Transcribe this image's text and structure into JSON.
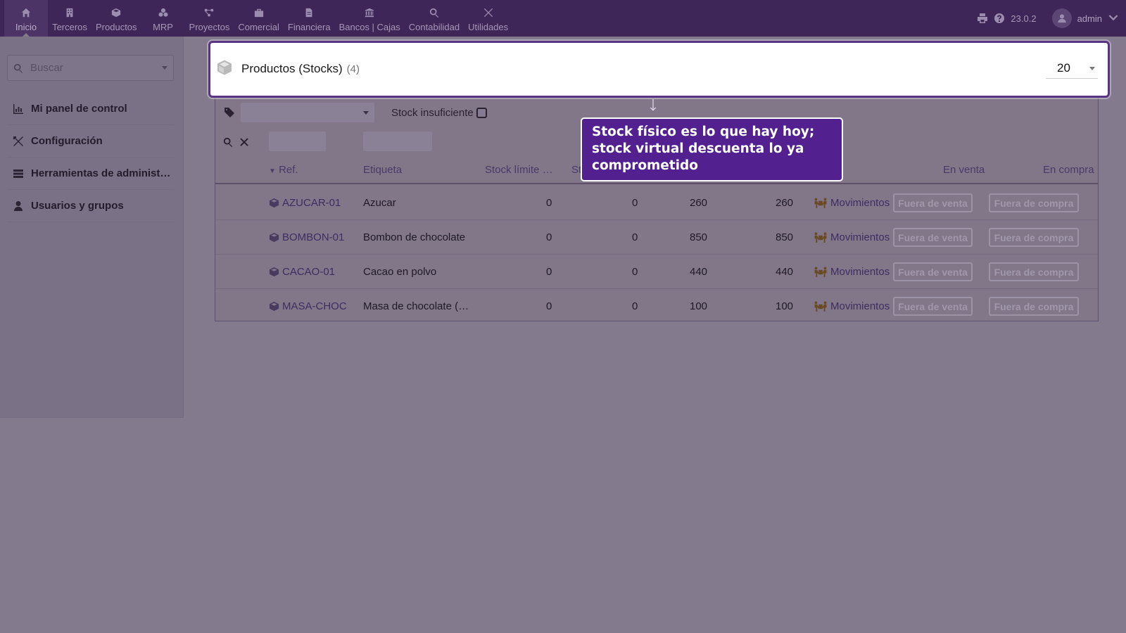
{
  "topbar": {
    "menu": [
      {
        "label": "Inicio",
        "icon": "home-icon",
        "active": true
      },
      {
        "label": "Terceros",
        "icon": "building-icon"
      },
      {
        "label": "Productos",
        "icon": "cube-icon"
      },
      {
        "label": "MRP",
        "icon": "cubes-icon"
      },
      {
        "label": "Proyectos",
        "icon": "project-diagram-icon"
      },
      {
        "label": "Comercial",
        "icon": "suitcase-icon"
      },
      {
        "label": "Financiera",
        "icon": "file-invoice-icon"
      },
      {
        "label": "Bancos | Cajas",
        "icon": "bank-icon"
      },
      {
        "label": "Contabilidad",
        "icon": "search-dollar-icon"
      },
      {
        "label": "Utilidades",
        "icon": "tools-icon"
      }
    ],
    "version": "23.0.2",
    "user": "admin"
  },
  "sidebar": {
    "search_placeholder": "Buscar",
    "items": [
      {
        "label": "Mi panel de control",
        "icon": "chart-bar-icon"
      },
      {
        "label": "Configuración",
        "icon": "tools-icon"
      },
      {
        "label": "Herramientas de administración",
        "icon": "server-icon"
      },
      {
        "label": "Usuarios y grupos",
        "icon": "user-icon"
      }
    ]
  },
  "popup": {
    "title": "Productos (Stocks)",
    "count": "(4)",
    "page_size": "20"
  },
  "filters": {
    "stock_insuficiente_label": "Stock insuficiente"
  },
  "table": {
    "headers": {
      "ref": "Ref.",
      "etiqueta": "Etiqueta",
      "stock_limite": "Stock límite …",
      "stock_partial": "St",
      "en_venta": "En venta",
      "en_compra": "En compra"
    },
    "rows": [
      {
        "ref": "AZUCAR-01",
        "label": "Azucar",
        "limit": "0",
        "desired": "0",
        "physical": "260",
        "virtual": "260",
        "movements": "Movimientos",
        "sale": "Fuera de venta",
        "purchase": "Fuera de compra"
      },
      {
        "ref": "BOMBON-01",
        "label": "Bombon de chocolate",
        "limit": "0",
        "desired": "0",
        "physical": "850",
        "virtual": "850",
        "movements": "Movimientos",
        "sale": "Fuera de venta",
        "purchase": "Fuera de compra"
      },
      {
        "ref": "CACAO-01",
        "label": "Cacao en polvo",
        "limit": "0",
        "desired": "0",
        "physical": "440",
        "virtual": "440",
        "movements": "Movimientos",
        "sale": "Fuera de venta",
        "purchase": "Fuera de compra"
      },
      {
        "ref": "MASA-CHOC",
        "label": "Masa de chocolate (…",
        "limit": "0",
        "desired": "0",
        "physical": "100",
        "virtual": "100",
        "movements": "Movimientos",
        "sale": "Fuera de venta",
        "purchase": "Fuera de compra"
      }
    ]
  },
  "tooltip": {
    "text": "Stock físico es lo que hay hoy; stock virtual descuenta lo ya comprometido"
  },
  "colors": {
    "topbar": "#3f2659",
    "tooltip_bg": "#52218f",
    "overlay": "#837a8e"
  }
}
